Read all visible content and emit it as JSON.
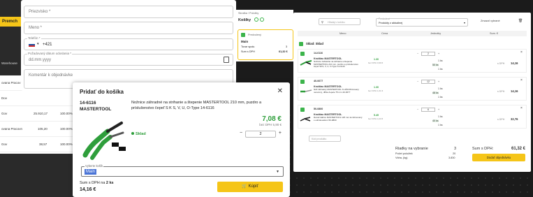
{
  "left_app": {
    "promo_label": "Premch",
    "warehouse_label": "Warehouse",
    "rows": [
      {
        "name": "Dov",
        "v1": "",
        "v2": ""
      },
      {
        "name": "Gov",
        "v1": "25.910,17",
        "v2": "100.00%"
      },
      {
        "name": "ovana Pracovn",
        "v1": "105,20",
        "v2": "100.00%"
      },
      {
        "name": "Gov",
        "v1": "38,57",
        "v2": "100.00%"
      }
    ],
    "row0_name": "ovana Pracov"
  },
  "order_form": {
    "surname_placeholder": "Priezvisko *",
    "name_placeholder": "Meno *",
    "phone_label": "Telefón *",
    "phone_prefix": "+421",
    "delivery_label": "Požadovaný dátum odoslania *",
    "delivery_placeholder": "dd.mm.yyyy",
    "comment_placeholder": "Komentár k objednávke"
  },
  "mini_cart": {
    "header": "Skratka / Položky",
    "title": "Košíky",
    "box_label": "Predvolený",
    "box_name": "Main",
    "items_label": "Tovar spolu",
    "items_value": "3",
    "sum_label": "Sum s DPH",
    "sum_value": "61,32 €"
  },
  "cart": {
    "search_placeholder": "Hľadaj v košíku",
    "cart_select_label": "Predvolené",
    "cart_select_value": "Produkty z aktuálnej",
    "delete_label": "Zmazať vybrané",
    "columns": [
      "Meno",
      "Cena",
      "Jednotky",
      "Sum. €"
    ],
    "store_label": "Sklad: Sklad",
    "items": [
      {
        "code": "14-6116",
        "brand": "Kruštiac MASTERTOOL",
        "desc": "Nožnice záhradné na strihanie a štepenie MASTERTOOL 210 mm, puzdro a príslušenstvo čepeľ SKS, V, U, O-Type 14-6116",
        "price": "1.30",
        "price_note": "bez DPH 0,99 €",
        "qty": "2",
        "unit1": "1 ks",
        "unit2": "50 ks",
        "unit3": "1 ks",
        "sum_label": "s DPH",
        "sum": "14,16"
      },
      {
        "code": "40-0677",
        "brand": "Kruštiac MASTERTOOL",
        "desc": "Nôž záhradný MASTERTOOL S HÁKOM kovaný nerezový, dĺžka čepele 75 mm 40-0677",
        "price": "1.30",
        "price_note": "bez DPH 1,01 €",
        "qty": "12",
        "unit1": "1 ks",
        "unit2": "48 ks",
        "unit3": "1 ks",
        "sum_label": "s DPH",
        "sum": "14,16"
      },
      {
        "code": "50-0800",
        "brand": "Kruštiac MASTERTOOL",
        "desc": "Rezač káblov MASTERTOOL 125 mm kombinovaný s odizolovačom 50-0800",
        "price": "5.45",
        "price_note": "bez DPH 4,43 €",
        "qty": "6",
        "unit1": "1 ks",
        "unit2": "40 ks",
        "unit3": "1 ks",
        "sum_label": "s DPH",
        "sum": "32,76"
      }
    ],
    "add_product_placeholder": "Kód produktu",
    "footer": {
      "rows_label": "Riadky na vybranie",
      "rows_value": "3",
      "count_label": "Počet položiek",
      "count_value": "20",
      "weight_label": "Váha, (kg)",
      "weight_value": "3.830",
      "total_label": "Sum s DPH:",
      "total_value": "61,32 €",
      "order_button": "Dodať objednávku"
    }
  },
  "modal": {
    "title": "Pridať do košíka",
    "code": "14-6116",
    "brand": "MASTERTOOL",
    "description": "Nožnice záhradné na strihanie a štepenie MASTERTOOL 210 mm, puzdro a príslušenstvo čepeľ S K S, V, U, O-Type 14-6116",
    "price": "7,08 €",
    "price_excl": "bez DPH 5,90 €",
    "stock": "Sklad",
    "quantity": "2",
    "cart_select_label": "Vyberte košík",
    "cart_select_value": "Main",
    "sum_label": "Sum s DPH na",
    "sum_qty": "2 ks",
    "sum_value": "14,16 €",
    "buy_button": "Kúpiť"
  },
  "colors": {
    "accent": "#f5c518",
    "green": "#2e9e3b",
    "background": "#1b1b1b"
  }
}
